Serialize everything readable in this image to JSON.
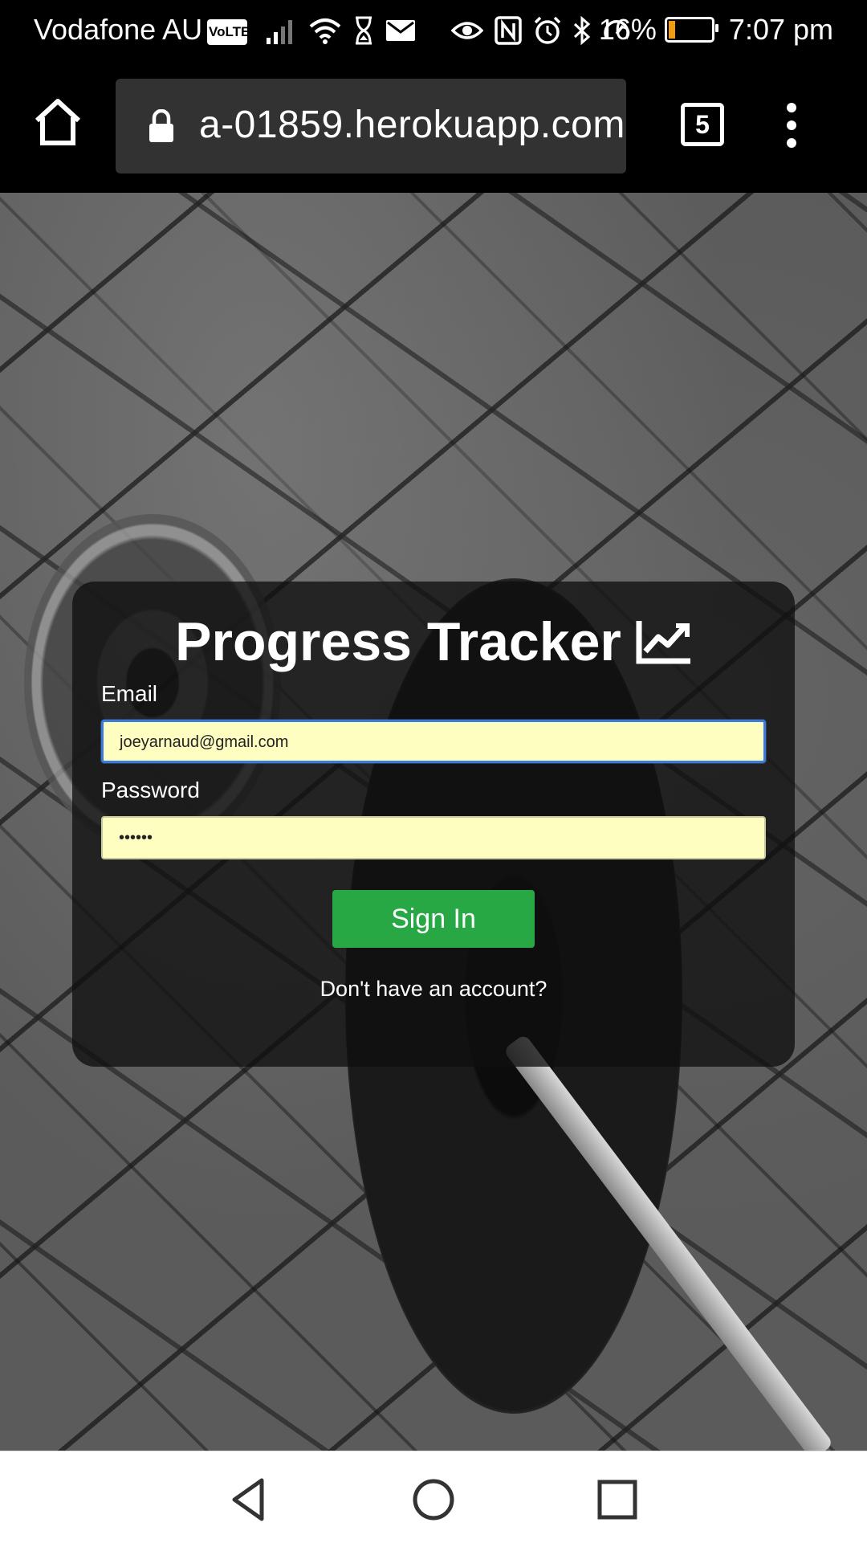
{
  "status_bar": {
    "carrier": "Vodafone AU",
    "volte": "VoLTE",
    "battery_percent": "16%",
    "battery_level": 0.16,
    "time": "7:07 pm",
    "icons": [
      "signal-icon",
      "wifi-icon",
      "hourglass-icon",
      "mail-icon",
      "eye-icon",
      "nfc-icon",
      "alarm-icon",
      "bluetooth-icon",
      "data-saver-icon",
      "battery-icon"
    ]
  },
  "browser": {
    "url": "a-01859.herokuapp.com",
    "tab_count": "5",
    "icons": [
      "home-icon",
      "lock-icon",
      "tabs-icon",
      "more-vert-icon"
    ]
  },
  "login": {
    "title": "Progress Tracker",
    "title_icon": "chart-line-icon",
    "email_label": "Email",
    "email_value": "joeyarnaud@gmail.com",
    "password_label": "Password",
    "password_value": "••••••",
    "signin_label": "Sign In",
    "register_link": "Don't have an account?",
    "button_color": "#28a745",
    "input_bg": "#fefec0"
  },
  "nav": {
    "icons": [
      "back-icon",
      "home-circle-icon",
      "recents-icon"
    ]
  }
}
